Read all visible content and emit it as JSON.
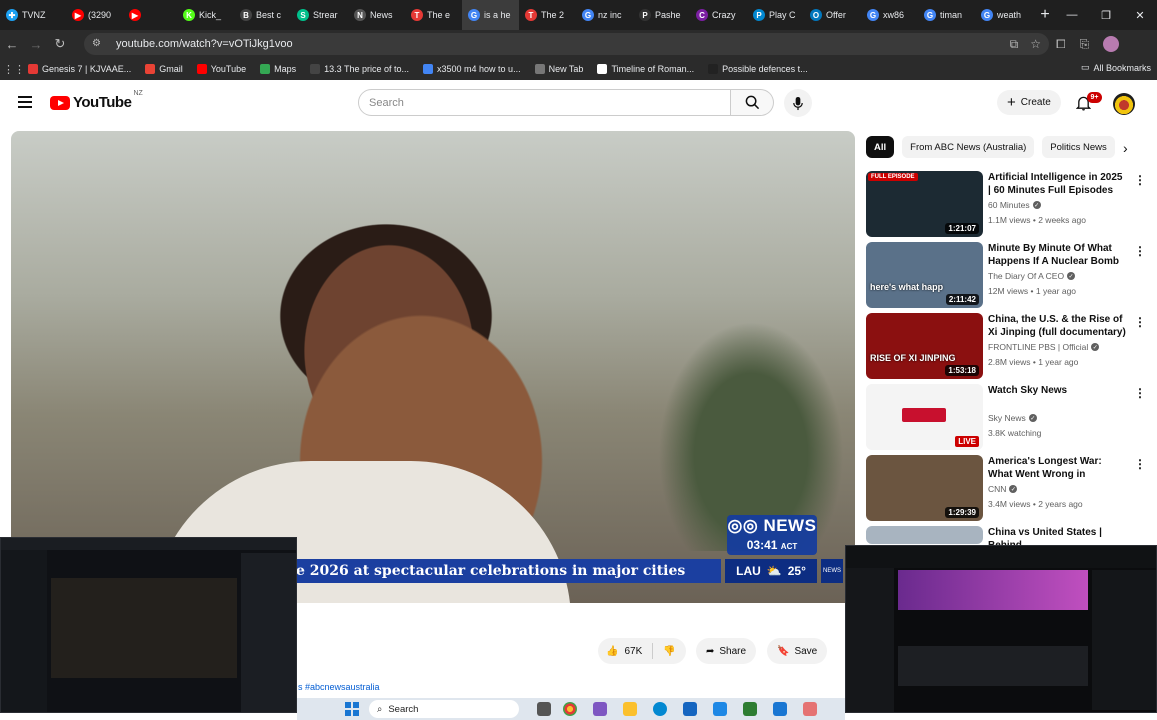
{
  "browser": {
    "tabs": [
      {
        "label": "TVNZ",
        "color": "#1da1f2",
        "glyph": "✚"
      },
      {
        "label": "(3290",
        "color": "#ff0000",
        "glyph": "▶"
      },
      {
        "label": "",
        "color": "#ff0000",
        "glyph": "▶"
      },
      {
        "label": "Kick_",
        "color": "#53fc18",
        "glyph": "K"
      },
      {
        "label": "Best c",
        "color": "#444444",
        "glyph": "B"
      },
      {
        "label": "Strear",
        "color": "#00c08b",
        "glyph": "S"
      },
      {
        "label": "News",
        "color": "#555555",
        "glyph": "N"
      },
      {
        "label": "The e",
        "color": "#e53935",
        "glyph": "T"
      },
      {
        "label": "is a he",
        "color": "#4285f4",
        "glyph": "G"
      },
      {
        "label": "The 2",
        "color": "#e53935",
        "glyph": "T"
      },
      {
        "label": "nz inc",
        "color": "#4285f4",
        "glyph": "G"
      },
      {
        "label": "Pashe",
        "color": "#333333",
        "glyph": "P"
      },
      {
        "label": "Crazy",
        "color": "#7b1fa2",
        "glyph": "C"
      },
      {
        "label": "Play C",
        "color": "#0288d1",
        "glyph": "P"
      },
      {
        "label": "Offer",
        "color": "#0277bd",
        "glyph": "O"
      },
      {
        "label": "xw86",
        "color": "#4285f4",
        "glyph": "G"
      },
      {
        "label": "timan",
        "color": "#4285f4",
        "glyph": "G"
      },
      {
        "label": "weath",
        "color": "#4285f4",
        "glyph": "G"
      }
    ],
    "url": "youtube.com/watch?v=vOTiJkg1voo",
    "bookmarks": [
      {
        "label": "Genesis 7 | KJVAAE...",
        "color": "#e53935"
      },
      {
        "label": "Gmail",
        "color": "#ea4335"
      },
      {
        "label": "YouTube",
        "color": "#ff0000"
      },
      {
        "label": "Maps",
        "color": "#34a853"
      },
      {
        "label": "13.3 The price of to...",
        "color": "#444444"
      },
      {
        "label": "x3500 m4 how to u...",
        "color": "#4285f4"
      },
      {
        "label": "New Tab",
        "color": "#777777"
      },
      {
        "label": "Timeline of Roman...",
        "color": "#ffffff"
      },
      {
        "label": "Possible defences t...",
        "color": "#222222"
      }
    ],
    "all_bookmarks": "All Bookmarks"
  },
  "youtube": {
    "logo_text": "YouTube",
    "region": "NZ",
    "search_placeholder": "Search",
    "create_label": "Create",
    "notif_badge": "9+",
    "video": {
      "ticker": "e 2026 at spectacular celebrations in major cities",
      "abc_news": "NEWS",
      "abc_time": "03:41",
      "abc_tz": "ACT",
      "weather_loc": "LAU",
      "weather_temp": "25°",
      "abc_mini": "NEWS"
    },
    "likes": "67K",
    "share_label": "Share",
    "save_label": "Save",
    "hashtag": "s #abcnewsaustralia",
    "chips": [
      "All",
      "From ABC News (Australia)",
      "Politics News"
    ],
    "recommendations": [
      {
        "title": "Artificial Intelligence in 2025 | 60 Minutes Full Episodes",
        "channel": "60 Minutes",
        "meta": "1.1M views • 2 weeks ago",
        "duration": "1:21:07",
        "badge": "FULL EPISODE",
        "bg": "#1c2a33"
      },
      {
        "title": "Minute By Minute Of What Happens If A Nuclear Bomb ...",
        "channel": "The Diary Of A CEO",
        "meta": "12M views • 1 year ago",
        "duration": "2:11:42",
        "badge": "",
        "bg": "#5a7189",
        "caption": "here's what happ"
      },
      {
        "title": "China, the U.S. & the Rise of Xi Jinping (full documentary) | ...",
        "channel": "FRONTLINE PBS | Official",
        "meta": "2.8M views • 1 year ago",
        "duration": "1:53:18",
        "badge": "",
        "bg": "#8b1010",
        "caption": "RISE OF XI JINPING"
      },
      {
        "title": "Watch Sky News",
        "channel": "Sky News",
        "meta": "3.8K watching",
        "duration": "",
        "badge": "LIVE",
        "bg": "#f4f4f4"
      },
      {
        "title": "America's Longest War: What Went Wrong in Afghanistan ...",
        "channel": "CNN",
        "meta": "3.4M views • 2 years ago",
        "duration": "1:29:39",
        "badge": "",
        "bg": "#6b5540"
      },
      {
        "title": "China vs United States | Behind",
        "channel": "",
        "meta": "",
        "duration": "",
        "badge": "",
        "bg": "#a8b4c0"
      }
    ]
  },
  "taskbar": {
    "search_label": "Search"
  }
}
